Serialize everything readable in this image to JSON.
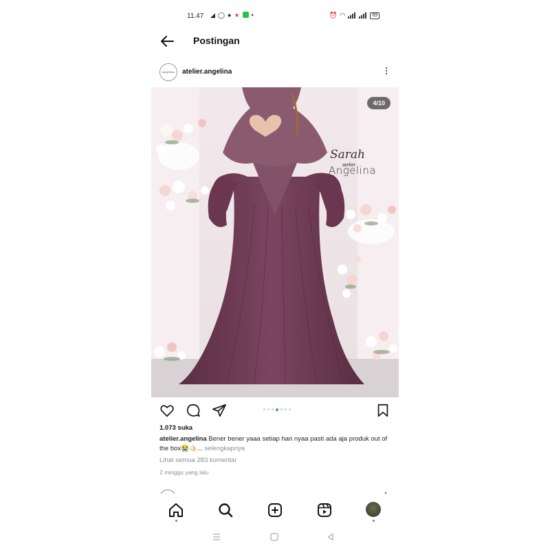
{
  "status_bar": {
    "time": "11.47",
    "left_icons": [
      "telegram-icon",
      "whatsapp-icon",
      "shazam-icon",
      "star-icon",
      "app-icon"
    ],
    "right_icons": [
      "alarm-icon",
      "wifi-icon",
      "volte-icon",
      "signal-icon",
      "signal-icon"
    ],
    "battery": "69"
  },
  "header": {
    "title": "Postingan"
  },
  "post": {
    "username": "atelier.angelina",
    "avatar_text": "Angelina",
    "image_counter": "4/10",
    "image_brand": {
      "line1": "Sarah",
      "line2": "atelier",
      "line3": "Angelina"
    },
    "carousel": {
      "count": 7,
      "active": 4
    },
    "likes": "1.073 suka",
    "caption_user": "atelier.angelina",
    "caption_text": "Bener bener yaaa setiap hari nyaa pasti ada aja produk out of the box😭🤙🏻...",
    "caption_more": "selengkapnya",
    "comments_link": "Lihat semua 283 komentar",
    "time_ago": "2 minggu yang lalu"
  },
  "colors": {
    "accent_blue": "#3897f0",
    "notification_red": "#ed4956",
    "dress": "#6e3a52",
    "hijab": "#8a5b6e"
  },
  "bottom_nav": [
    "home-icon",
    "search-icon",
    "create-icon",
    "reels-icon",
    "profile-avatar"
  ],
  "system_nav": [
    "recents-icon",
    "home-button-icon",
    "back-triangle-icon"
  ]
}
